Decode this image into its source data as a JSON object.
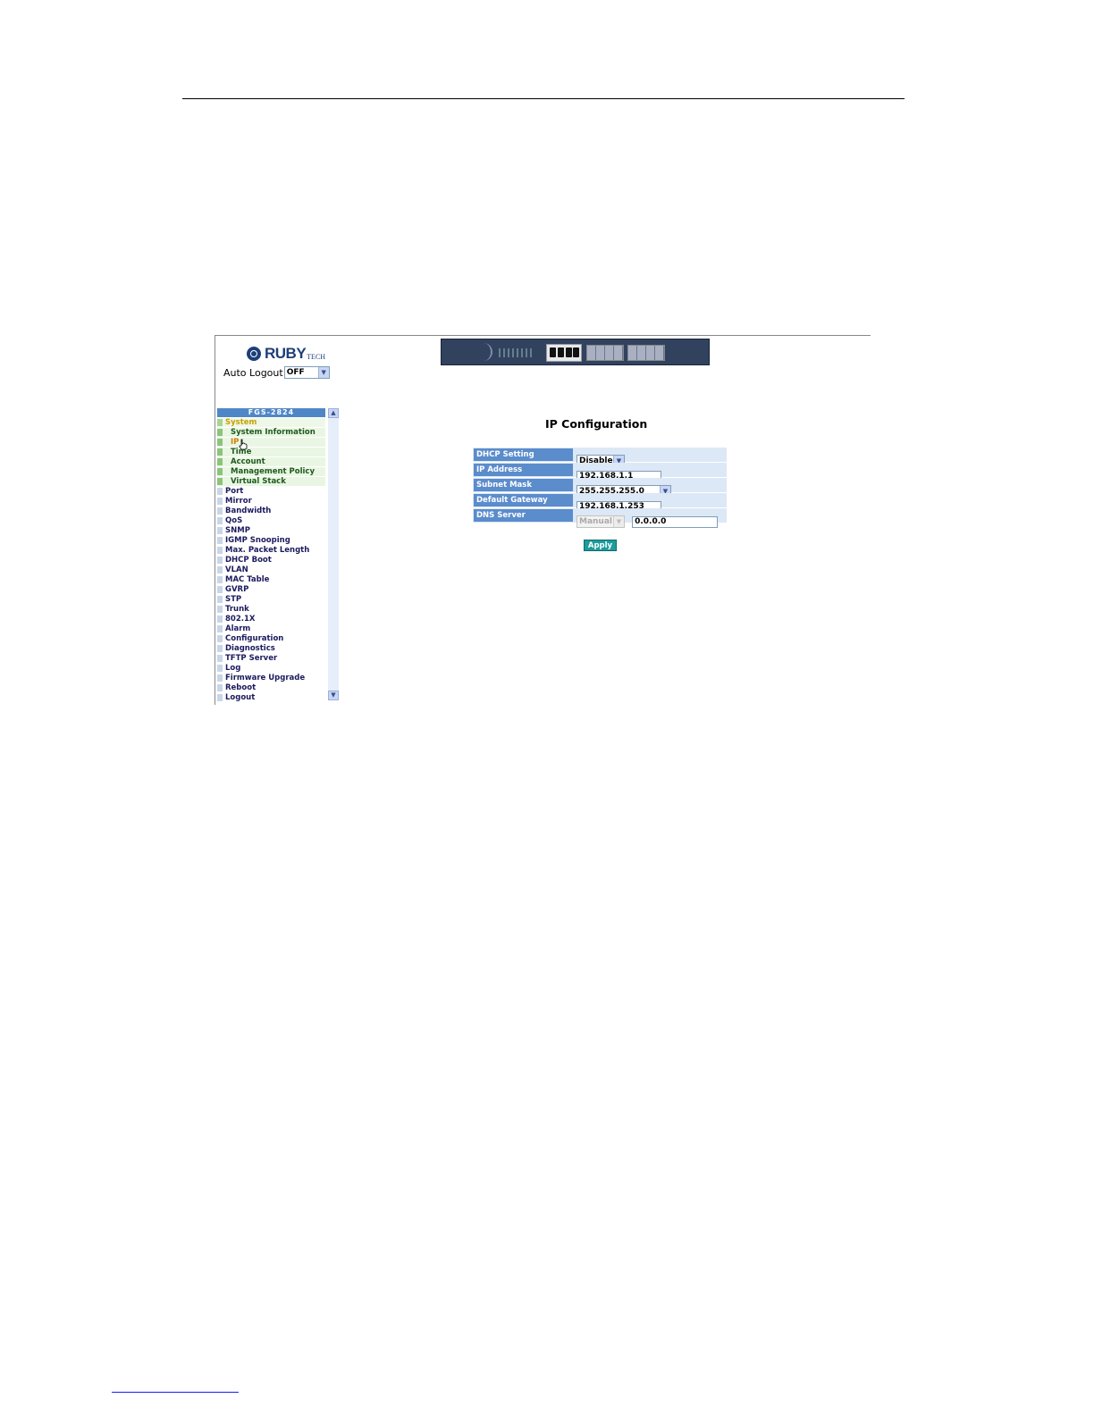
{
  "logo": {
    "text": "RUBY",
    "sub": "TECH"
  },
  "auto_logout": {
    "label": "Auto Logout",
    "value": "OFF"
  },
  "tree": {
    "title": "FGS-2824",
    "items": [
      {
        "label": "System",
        "kind": "open"
      },
      {
        "label": "System Information",
        "kind": "sub"
      },
      {
        "label": "IP",
        "kind": "sub-active"
      },
      {
        "label": "Time",
        "kind": "sub"
      },
      {
        "label": "Account",
        "kind": "sub"
      },
      {
        "label": "Management Policy",
        "kind": "sub"
      },
      {
        "label": "Virtual Stack",
        "kind": "sub"
      },
      {
        "label": "Port",
        "kind": "top"
      },
      {
        "label": "Mirror",
        "kind": "top"
      },
      {
        "label": "Bandwidth",
        "kind": "top"
      },
      {
        "label": "QoS",
        "kind": "top"
      },
      {
        "label": "SNMP",
        "kind": "top"
      },
      {
        "label": "IGMP Snooping",
        "kind": "top"
      },
      {
        "label": "Max. Packet Length",
        "kind": "top"
      },
      {
        "label": "DHCP Boot",
        "kind": "top"
      },
      {
        "label": "VLAN",
        "kind": "top"
      },
      {
        "label": "MAC Table",
        "kind": "top"
      },
      {
        "label": "GVRP",
        "kind": "top"
      },
      {
        "label": "STP",
        "kind": "top"
      },
      {
        "label": "Trunk",
        "kind": "top"
      },
      {
        "label": "802.1X",
        "kind": "top"
      },
      {
        "label": "Alarm",
        "kind": "top"
      },
      {
        "label": "Configuration",
        "kind": "top"
      },
      {
        "label": "Diagnostics",
        "kind": "top"
      },
      {
        "label": "TFTP Server",
        "kind": "top"
      },
      {
        "label": "Log",
        "kind": "top"
      },
      {
        "label": "Firmware Upgrade",
        "kind": "top"
      },
      {
        "label": "Reboot",
        "kind": "top"
      },
      {
        "label": "Logout",
        "kind": "top"
      }
    ]
  },
  "main": {
    "title": "IP Configuration",
    "dhcp_setting": {
      "label": "DHCP Setting",
      "value": "Disable"
    },
    "ip_address": {
      "label": "IP Address",
      "value": "192.168.1.1"
    },
    "subnet_mask": {
      "label": "Subnet Mask",
      "value": "255.255.255.0"
    },
    "default_gateway": {
      "label": "Default Gateway",
      "value": "192.168.1.253"
    },
    "dns_server": {
      "label": "DNS Server",
      "mode": "Manual",
      "value": "0.0.0.0"
    },
    "apply_label": "Apply"
  },
  "colors": {
    "label_bg": "#5b8ccc",
    "row_bg": "#dce8f6",
    "apply_bg": "#1e9b9b",
    "tree_title_bg": "#4f87c6"
  }
}
